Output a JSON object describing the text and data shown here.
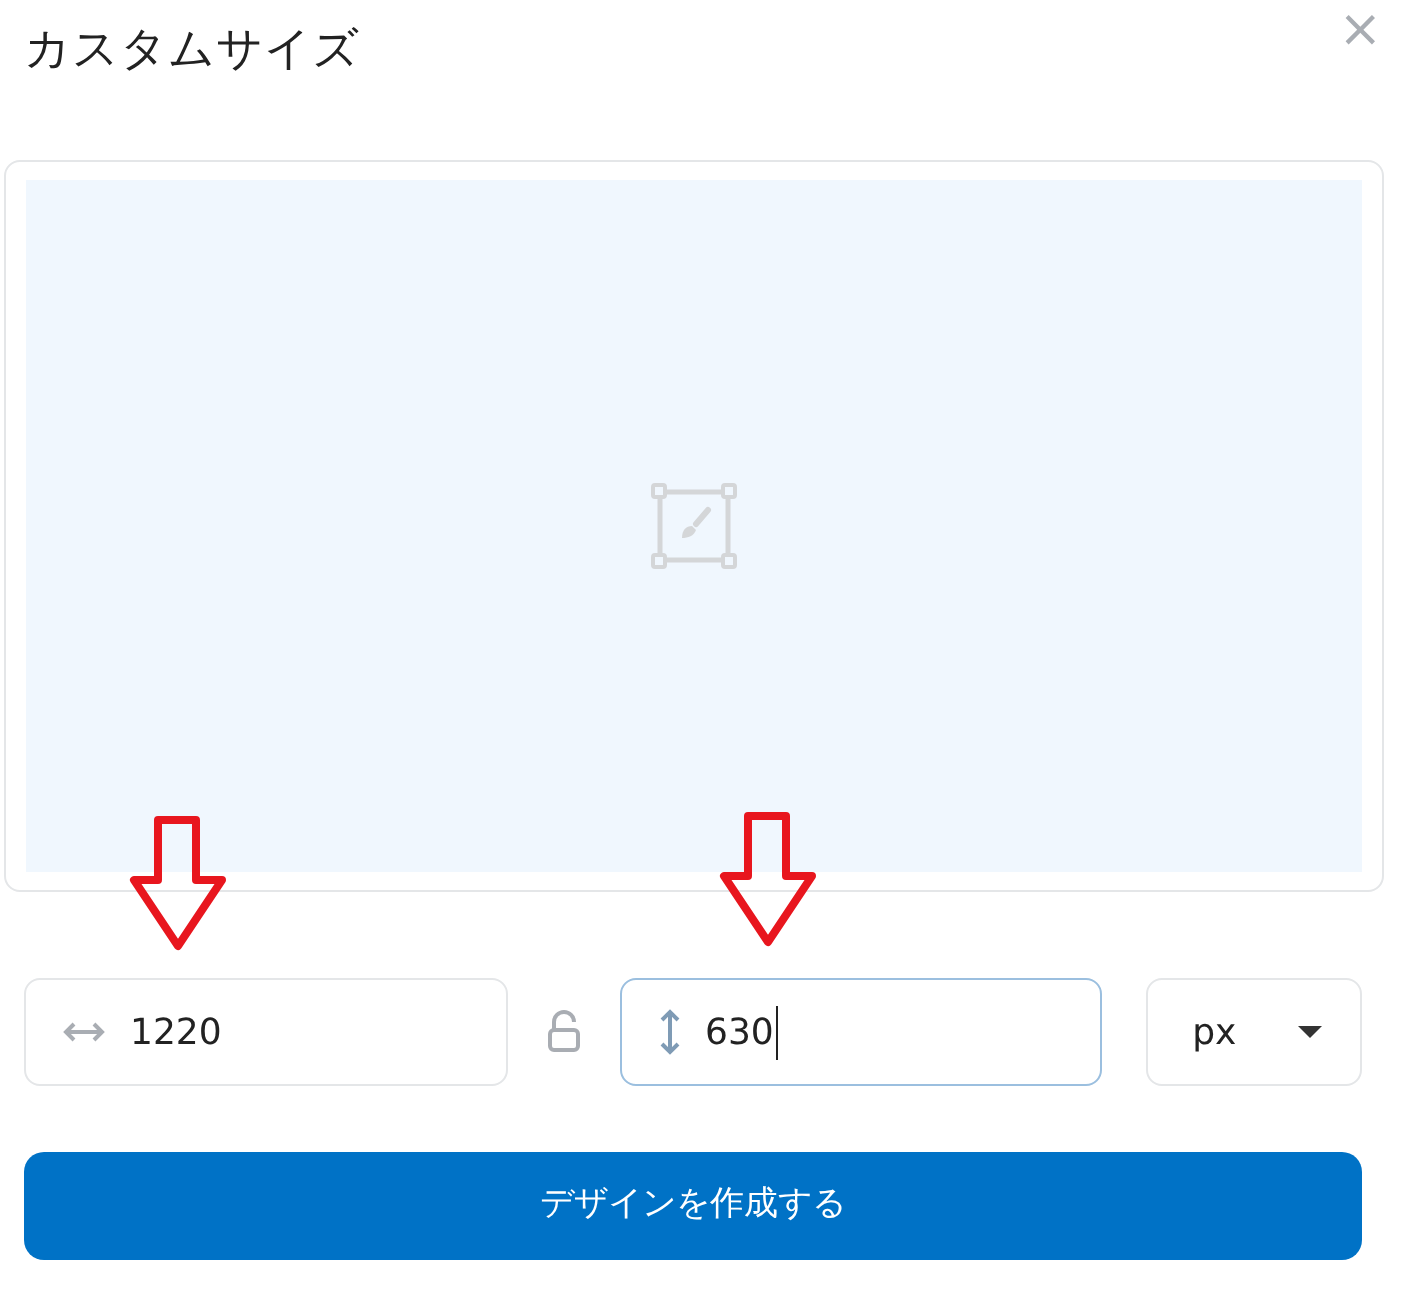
{
  "dialog": {
    "title": "カスタムサイズ",
    "close": "×"
  },
  "preview": {
    "kind": "placeholder"
  },
  "fields": [
    {
      "kind": "width",
      "value": "1220",
      "focused": false
    },
    {
      "kind": "height",
      "value": "630",
      "focused": true
    }
  ],
  "lock": {
    "locked": false
  },
  "unit": {
    "value": "px"
  },
  "submit": {
    "label": "デザインを作成する"
  }
}
